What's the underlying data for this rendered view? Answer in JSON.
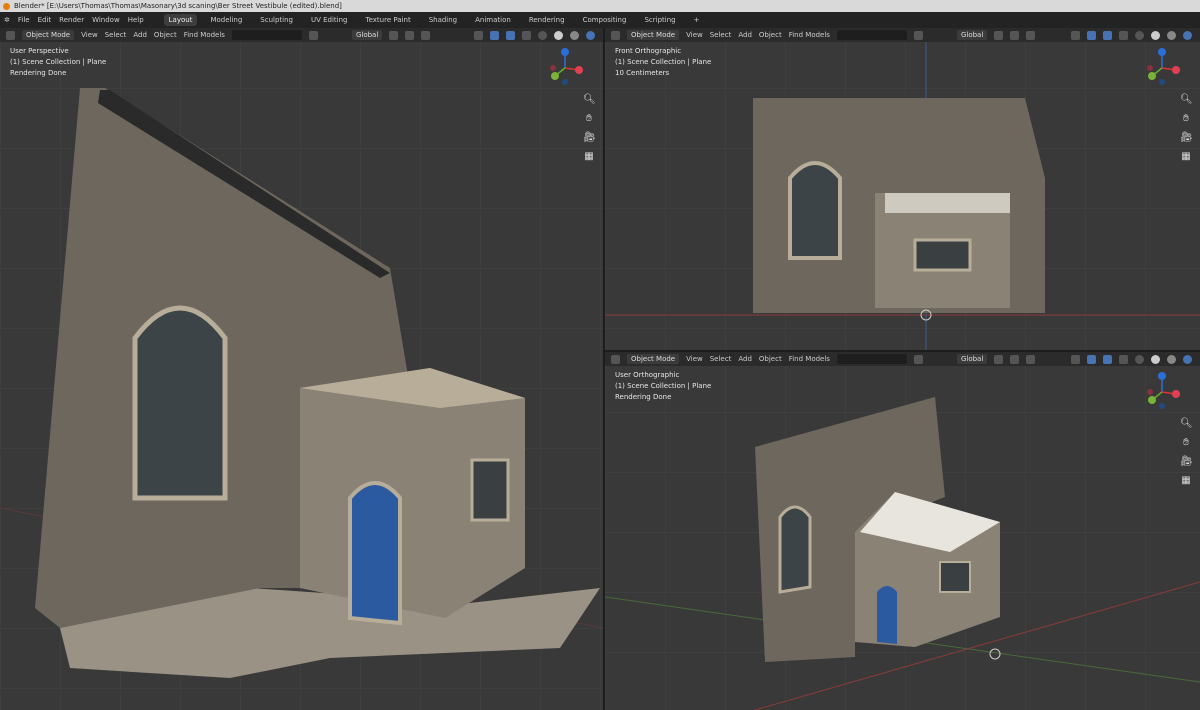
{
  "title": "Blender* [E:\\Users\\Thomas\\Thomas\\Masonary\\3d scaning\\Ber Street Vestibule (edited).blend]",
  "menu": [
    "File",
    "Edit",
    "Render",
    "Window",
    "Help"
  ],
  "workspaces": [
    "Layout",
    "Modeling",
    "Sculpting",
    "UV Editing",
    "Texture Paint",
    "Shading",
    "Animation",
    "Rendering",
    "Compositing",
    "Scripting",
    "+"
  ],
  "header": {
    "mode": "Object Mode",
    "view": "View",
    "select": "Select",
    "add": "Add",
    "object": "Object",
    "find": "Find Models",
    "orientation": "Global"
  },
  "viewports": [
    {
      "lines": [
        "User Perspective",
        "(1) Scene Collection | Plane",
        "Rendering Done"
      ]
    },
    {
      "lines": [
        "Front Orthographic",
        "(1) Scene Collection | Plane",
        "10 Centimeters"
      ]
    },
    {
      "lines": [
        "User Orthographic",
        "(1) Scene Collection | Plane",
        "Rendering Done"
      ]
    }
  ],
  "nav_icons": [
    "zoom-icon",
    "hand-pan-icon",
    "camera-icon",
    "grid-icon"
  ]
}
